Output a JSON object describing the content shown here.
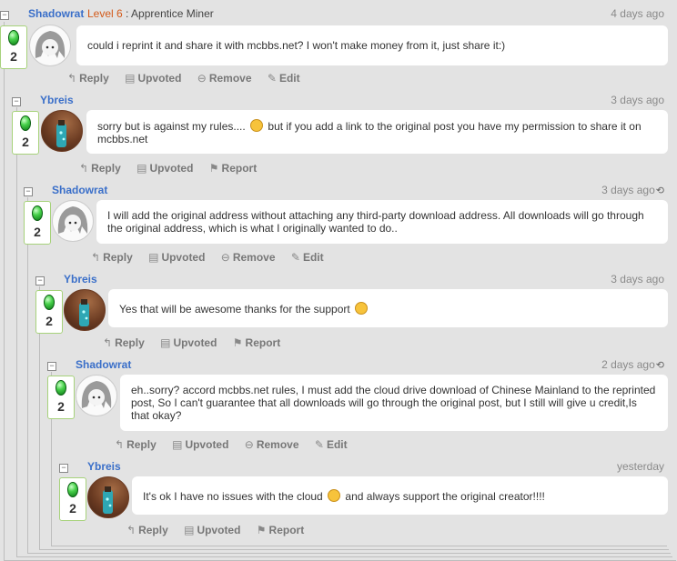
{
  "actions": {
    "reply": "Reply",
    "upvoted": "Upvoted",
    "remove": "Remove",
    "edit": "Edit",
    "report": "Report"
  },
  "header": {
    "level": "Level 6",
    "separator": " : ",
    "rank": "Apprentice Miner"
  },
  "comments": [
    {
      "user": "Shadowrat",
      "date": "4 days ago",
      "votes": "2",
      "text": "could i reprint it and share it with mcbbs.net? I won't make money from it, just share it:)"
    },
    {
      "user": "Ybreis",
      "date": "3 days ago",
      "votes": "2",
      "text_a": "sorry but is against my rules.... ",
      "text_b": " but if you add a link to the original post you have my permission to share it on mcbbs.net"
    },
    {
      "user": "Shadowrat",
      "date": "3 days ago",
      "votes": "2",
      "text": "I will add the original address without attaching any third-party download address. All downloads will go through the original address, which is what I originally wanted to do.."
    },
    {
      "user": "Ybreis",
      "date": "3 days ago",
      "votes": "2",
      "text_a": "Yes that will be awesome thanks for the support "
    },
    {
      "user": "Shadowrat",
      "date": "2 days ago",
      "votes": "2",
      "text": "eh..sorry? accord mcbbs.net rules, I must add the cloud drive download of Chinese Mainland to the reprinted post, So I can't guarantee that all downloads will go through the original post, but I still will give u credit,Is that okay?"
    },
    {
      "user": "Ybreis",
      "date": "yesterday",
      "votes": "2",
      "text_a": "It's ok I have no issues with the cloud ",
      "text_b": " and always support the original creator!!!!"
    }
  ]
}
